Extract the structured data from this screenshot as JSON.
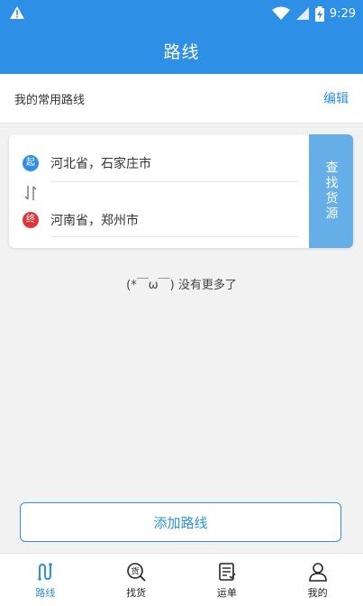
{
  "status_bar": {
    "time": "9:29"
  },
  "app_bar": {
    "title": "路线"
  },
  "section": {
    "title": "我的常用路线",
    "edit_label": "编辑"
  },
  "route": {
    "start_badge": "起",
    "end_badge": "终",
    "from": "河北省，石家庄市",
    "to": "河南省，郑州市",
    "search_label": "查找货源"
  },
  "no_more_text": "(*￣ω￣) 没有更多了",
  "add_button_label": "添加路线",
  "tabs": [
    {
      "label": "路线",
      "icon": "route-icon",
      "active": true
    },
    {
      "label": "找货",
      "icon": "find-goods-icon",
      "active": false
    },
    {
      "label": "运单",
      "icon": "waybill-icon",
      "active": false
    },
    {
      "label": "我的",
      "icon": "profile-icon",
      "active": false
    }
  ],
  "colors": {
    "primary": "#2e8fe6",
    "search_button": "#66aee8",
    "end_red": "#e0363a"
  }
}
